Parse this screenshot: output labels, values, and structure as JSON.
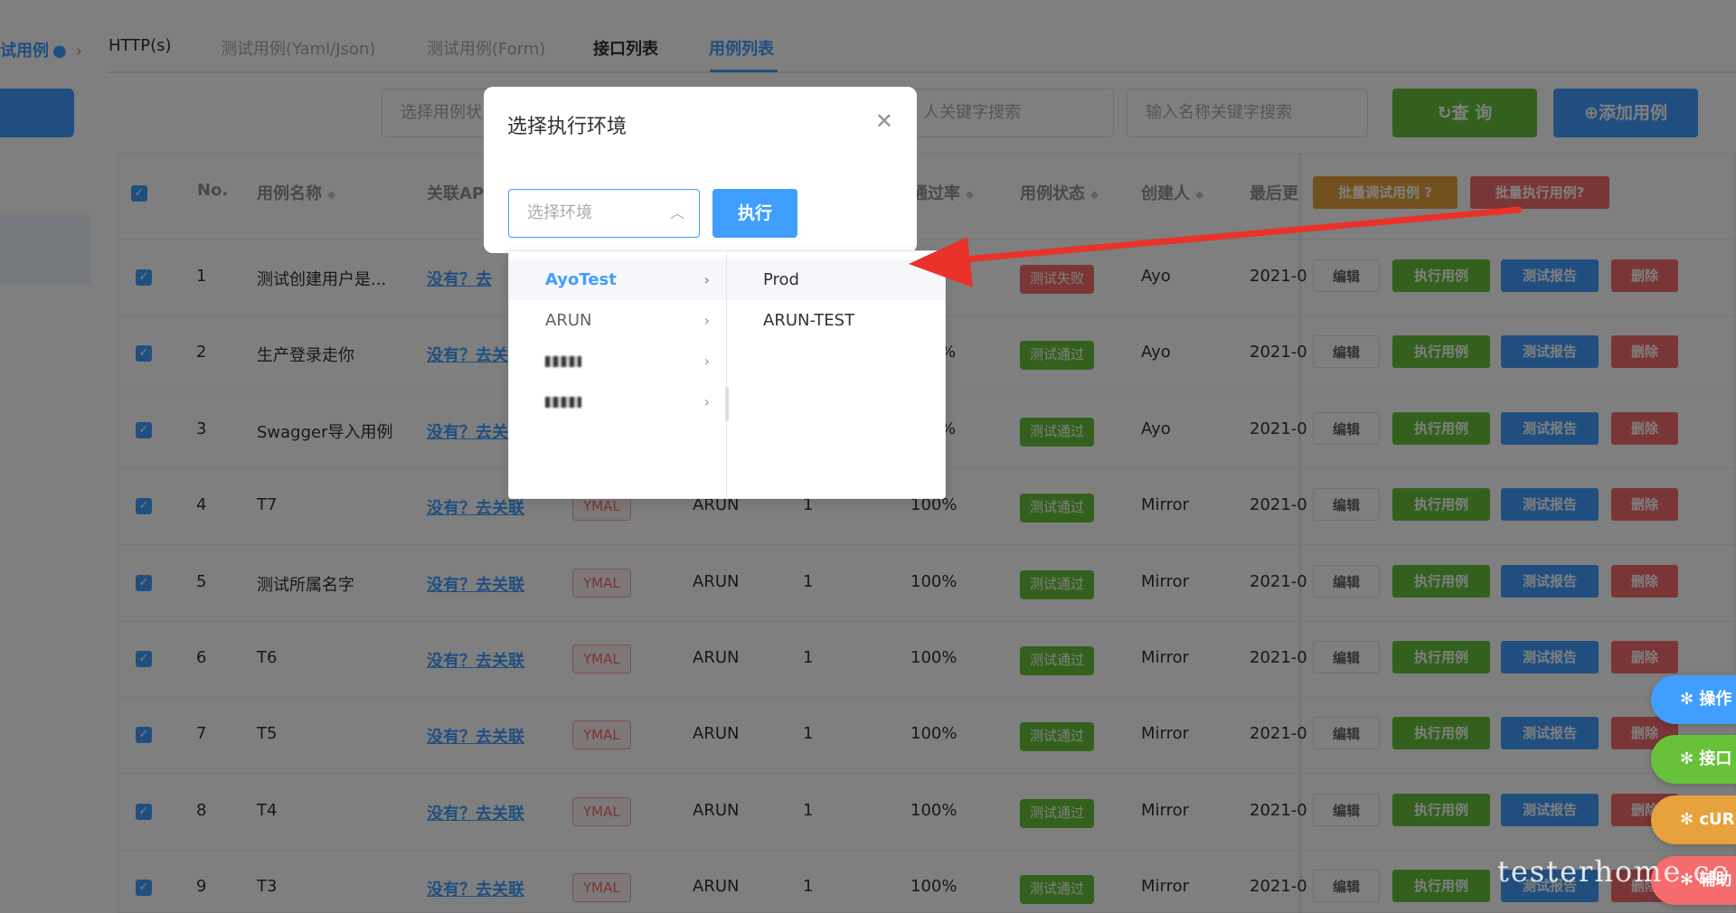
{
  "breadcrumb": {
    "label": "试用例",
    "icon": "chevron-right"
  },
  "tabs": [
    {
      "label": "HTTP(s)"
    },
    {
      "label": "测试用例(Yaml/Json)"
    },
    {
      "label": "测试用例(Form)"
    },
    {
      "label": "接口列表"
    },
    {
      "label": "用例列表"
    }
  ],
  "filters": {
    "case_type_placeholder": "选择用例状",
    "keyword_placeholder": "人关键字搜索",
    "name_placeholder": "输入名称关键字搜索",
    "query_label": "查 询",
    "add_label": "添加用例"
  },
  "table": {
    "headers": {
      "no": "No.",
      "name": "用例名称",
      "api": "关联AP",
      "pass_rate": "通过率",
      "status": "用例状态",
      "creator": "创建人",
      "last": "最后更"
    },
    "batch_debug": "批量调试用例",
    "batch_run": "批量执行用例",
    "actions": {
      "edit": "编辑",
      "run": "执行用例",
      "report": "测试报告",
      "delete": "删除"
    },
    "rows": [
      {
        "no": "1",
        "name": "测试创建用户是...",
        "api": "没有？去",
        "tag": "",
        "env": "",
        "count": "",
        "rate": "",
        "status": "测试失败",
        "creator": "Ayo",
        "date": "2021-0"
      },
      {
        "no": "2",
        "name": "生产登录走你",
        "api": "没有？去关",
        "tag": "",
        "env": "",
        "count": "",
        "rate": "%",
        "status": "测试通过",
        "creator": "Ayo",
        "date": "2021-0"
      },
      {
        "no": "3",
        "name": "Swagger导入用例",
        "api": "没有？去关",
        "tag": "",
        "env": "",
        "count": "",
        "rate": "%",
        "status": "测试通过",
        "creator": "Ayo",
        "date": "2021-0"
      },
      {
        "no": "4",
        "name": "T7",
        "api": "没有？去关联",
        "tag": "YMAL",
        "env": "ARUN",
        "count": "1",
        "rate": "100%",
        "status": "测试通过",
        "creator": "Mirror",
        "date": "2021-0"
      },
      {
        "no": "5",
        "name": "测试所属名字",
        "api": "没有？去关联",
        "tag": "YMAL",
        "env": "ARUN",
        "count": "1",
        "rate": "100%",
        "status": "测试通过",
        "creator": "Mirror",
        "date": "2021-0"
      },
      {
        "no": "6",
        "name": "T6",
        "api": "没有？去关联",
        "tag": "YMAL",
        "env": "ARUN",
        "count": "1",
        "rate": "100%",
        "status": "测试通过",
        "creator": "Mirror",
        "date": "2021-0"
      },
      {
        "no": "7",
        "name": "T5",
        "api": "没有？去关联",
        "tag": "YMAL",
        "env": "ARUN",
        "count": "1",
        "rate": "100%",
        "status": "测试通过",
        "creator": "Mirror",
        "date": "2021-0"
      },
      {
        "no": "8",
        "name": "T4",
        "api": "没有？去关联",
        "tag": "YMAL",
        "env": "ARUN",
        "count": "1",
        "rate": "100%",
        "status": "测试通过",
        "creator": "Mirror",
        "date": "2021-0"
      },
      {
        "no": "9",
        "name": "T3",
        "api": "没有？去关联",
        "tag": "YMAL",
        "env": "ARUN",
        "count": "1",
        "rate": "100%",
        "status": "测试通过",
        "creator": "Mirror",
        "date": "2021-0"
      }
    ]
  },
  "floating": [
    "操作",
    "接口",
    "cUR",
    "辅助"
  ],
  "dialog": {
    "title": "选择执行环境",
    "select_placeholder": "选择环境",
    "execute_label": "执行"
  },
  "cascader": {
    "left": [
      "AyoTest",
      "ARUN"
    ],
    "right": [
      "Prod",
      "ARUN-TEST"
    ]
  },
  "watermark": "testerhome.cc",
  "colors": {
    "primary": "#409eff",
    "success": "#67c23a",
    "danger": "#f56c6c",
    "warning": "#e6a23c",
    "annotation": "#e8322a"
  }
}
